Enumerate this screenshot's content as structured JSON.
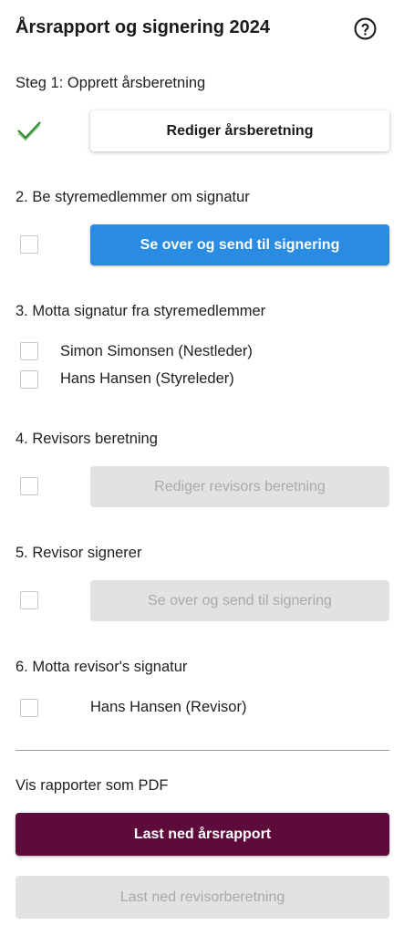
{
  "header": {
    "title": "Årsrapport og signering 2024",
    "help_icon": "question-circle-icon"
  },
  "steps": [
    {
      "label": "Steg 1: Opprett årsberetning",
      "status": "completed",
      "status_icon": "checkmark-icon",
      "button_label": "Rediger årsberetning"
    },
    {
      "label": "2. Be styremedlemmer om signatur",
      "status": "pending",
      "button_label": "Se over og send til signering"
    },
    {
      "label": "3. Motta signatur fra styremedlemmer",
      "signers": [
        "Simon Simonsen (Nestleder)",
        "Hans Hansen (Styreleder)"
      ]
    },
    {
      "label": "4. Revisors beretning",
      "status": "disabled",
      "button_label": "Rediger revisors beretning"
    },
    {
      "label": "5. Revisor signerer",
      "status": "disabled",
      "button_label": "Se over og send til signering"
    },
    {
      "label": "6. Motta revisor's signatur",
      "signers": [
        "Hans Hansen (Revisor)"
      ]
    }
  ],
  "pdf": {
    "label": "Vis rapporter som PDF",
    "download_annual_label": "Last ned årsrapport",
    "download_auditor_label": "Last ned revisorberetning"
  },
  "colors": {
    "primary_blue": "#2a8be3",
    "brand_plum": "#5c0b3b",
    "check_green": "#2e8b2e",
    "disabled_bg": "#e2e2e2",
    "disabled_text": "#a9a9a9"
  }
}
